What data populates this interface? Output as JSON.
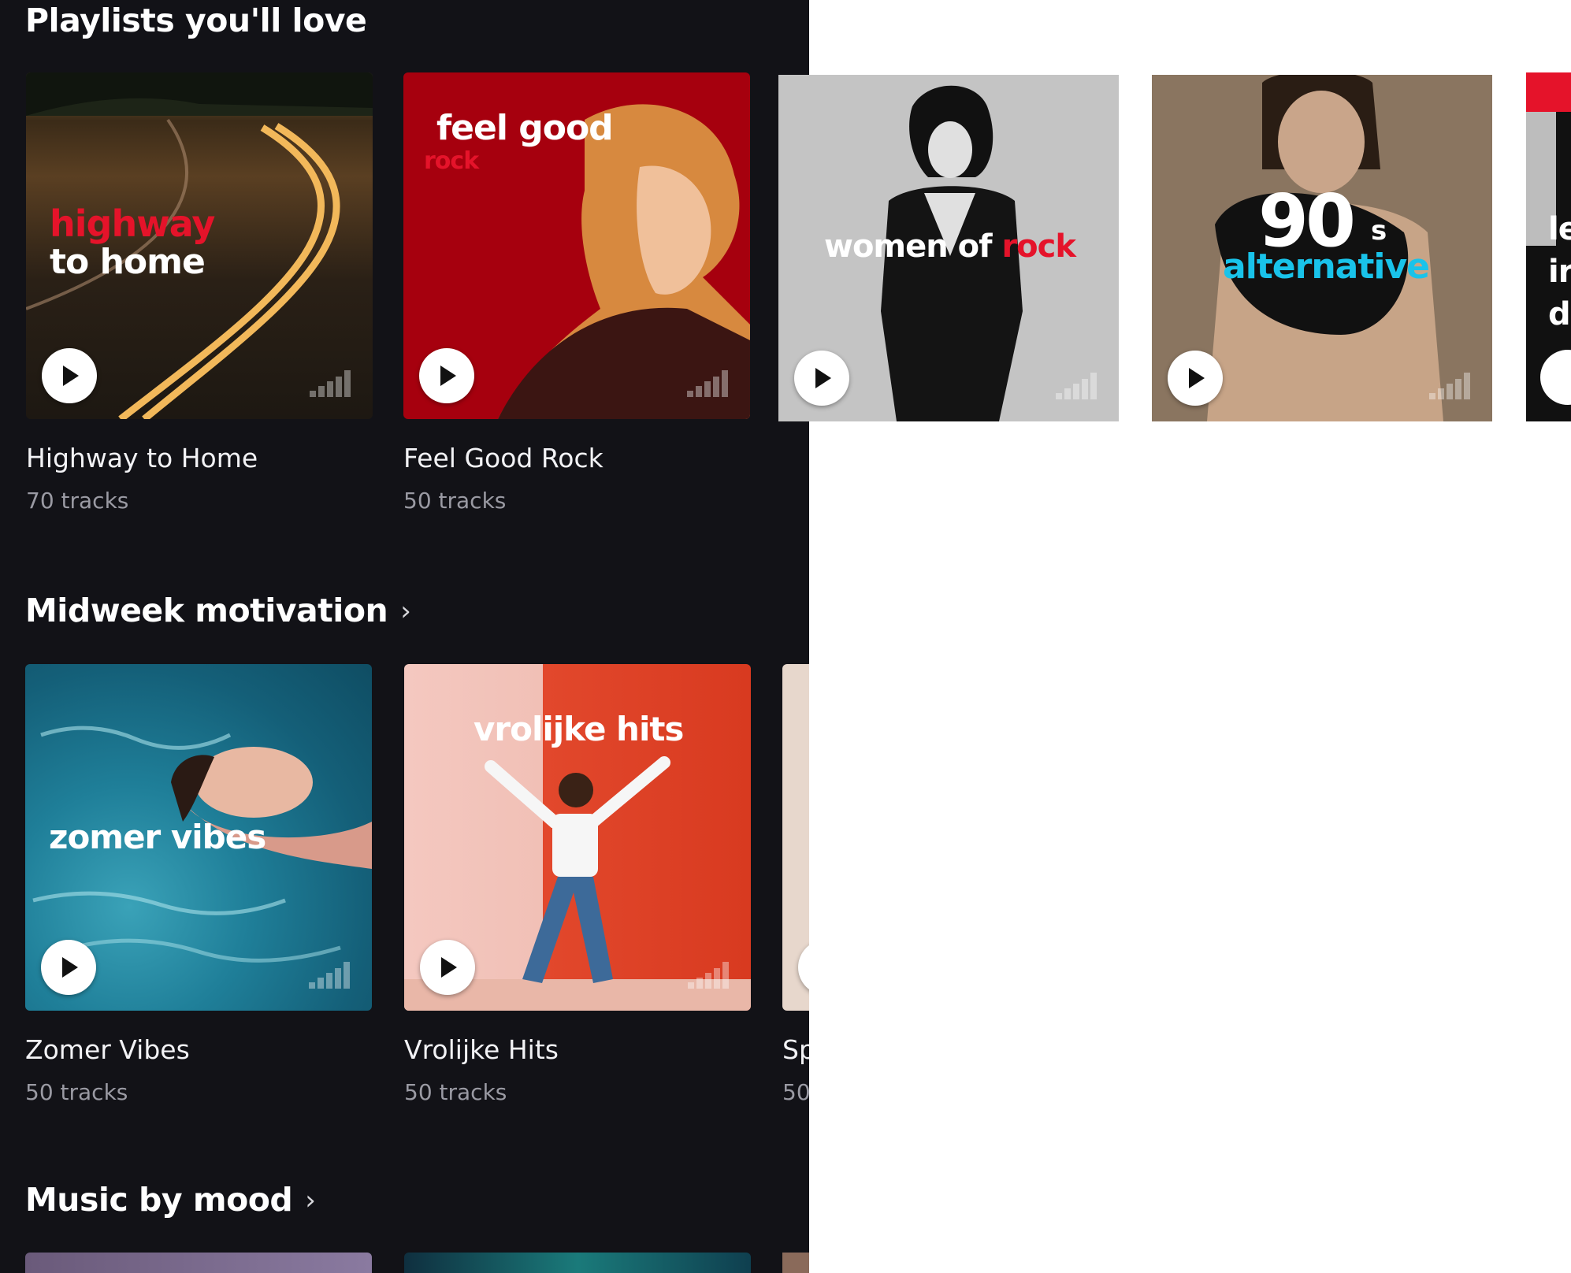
{
  "sections": {
    "playlists": {
      "title": "Playlists you'll love",
      "cards": [
        {
          "title": "Highway to Home",
          "subtitle": "70 tracks",
          "overlay_line1": "highway",
          "overlay_line2": "to home"
        },
        {
          "title": "Feel Good Rock",
          "subtitle": "50 tracks",
          "overlay_line1": "feel good",
          "overlay_line2": "rock"
        }
      ]
    },
    "midweek": {
      "title": "Midweek motivation",
      "chevron": "›",
      "cards": [
        {
          "title": "Zomer Vibes",
          "subtitle": "50 tracks",
          "overlay": "zomer vibes"
        },
        {
          "title": "Vrolijke Hits",
          "subtitle": "50 tracks",
          "overlay": "vrolijke hits"
        },
        {
          "title": "Sp",
          "subtitle": "50"
        }
      ]
    },
    "mood": {
      "title": "Music by mood",
      "chevron": "›"
    }
  },
  "wide_cards": [
    {
      "overlay_white": "women of ",
      "overlay_red": "rock"
    },
    {
      "overlay_big": "90",
      "overlay_s": "s",
      "overlay_alt": "alternative"
    },
    {
      "overlay_partial": [
        "le",
        "ir",
        "d"
      ]
    }
  ],
  "colors": {
    "background": "#121217",
    "text_primary": "#f2f2f5",
    "text_secondary": "#9a9aa3",
    "accent_red": "#e5132a",
    "accent_cyan": "#19c3ea"
  },
  "icons": [
    "play-icon",
    "equalizer-icon",
    "chevron-right-icon"
  ]
}
